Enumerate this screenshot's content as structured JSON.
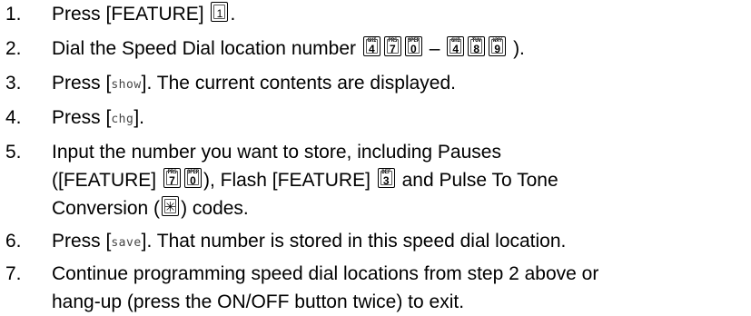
{
  "steps": [
    {
      "num": "1.",
      "text_1": "Press [FEATURE] ",
      "key_1": "1",
      "text_2": "."
    },
    {
      "num": "2.",
      "text_1": "Dial the Speed Dial location number ",
      "keys_a": [
        {
          "letters": "GHI",
          "digit": "4"
        },
        {
          "letters": "PRS",
          "digit": "7"
        },
        {
          "letters": "OPER",
          "digit": "0"
        }
      ],
      "dash": " – ",
      "keys_b": [
        {
          "letters": "GHI",
          "digit": "4"
        },
        {
          "letters": "TUV",
          "digit": "8"
        },
        {
          "letters": "WXY",
          "digit": "9"
        }
      ],
      "text_2": " )."
    },
    {
      "num": "3.",
      "text_1": "Press [",
      "softkey": "show",
      "text_2": "]. The current contents are displayed."
    },
    {
      "num": "4.",
      "text_1": "Press [",
      "softkey": "chg",
      "text_2": "]."
    },
    {
      "num": "5.",
      "line_1": "Input the number you want to store, including Pauses",
      "line_2_a": "([FEATURE] ",
      "key_prs": {
        "letters": "PRS",
        "digit": "7"
      },
      "key_oper": {
        "letters": "OPER",
        "digit": "0"
      },
      "line_2_b": "), Flash [FEATURE] ",
      "key_def": {
        "letters": "DEF",
        "digit": "3"
      },
      "line_2_c": " and Pulse To Tone",
      "line_3_a": "Conversion (",
      "key_star": "✳",
      "line_3_b": ") codes."
    },
    {
      "num": "6.",
      "text_1": "Press [",
      "softkey": "save",
      "text_2": "]. That number is stored in this speed dial location."
    },
    {
      "num": "7.",
      "line_1": "Continue programming speed dial locations from step 2 above or",
      "line_2": "hang-up (press the ON/OFF button twice) to exit."
    }
  ]
}
